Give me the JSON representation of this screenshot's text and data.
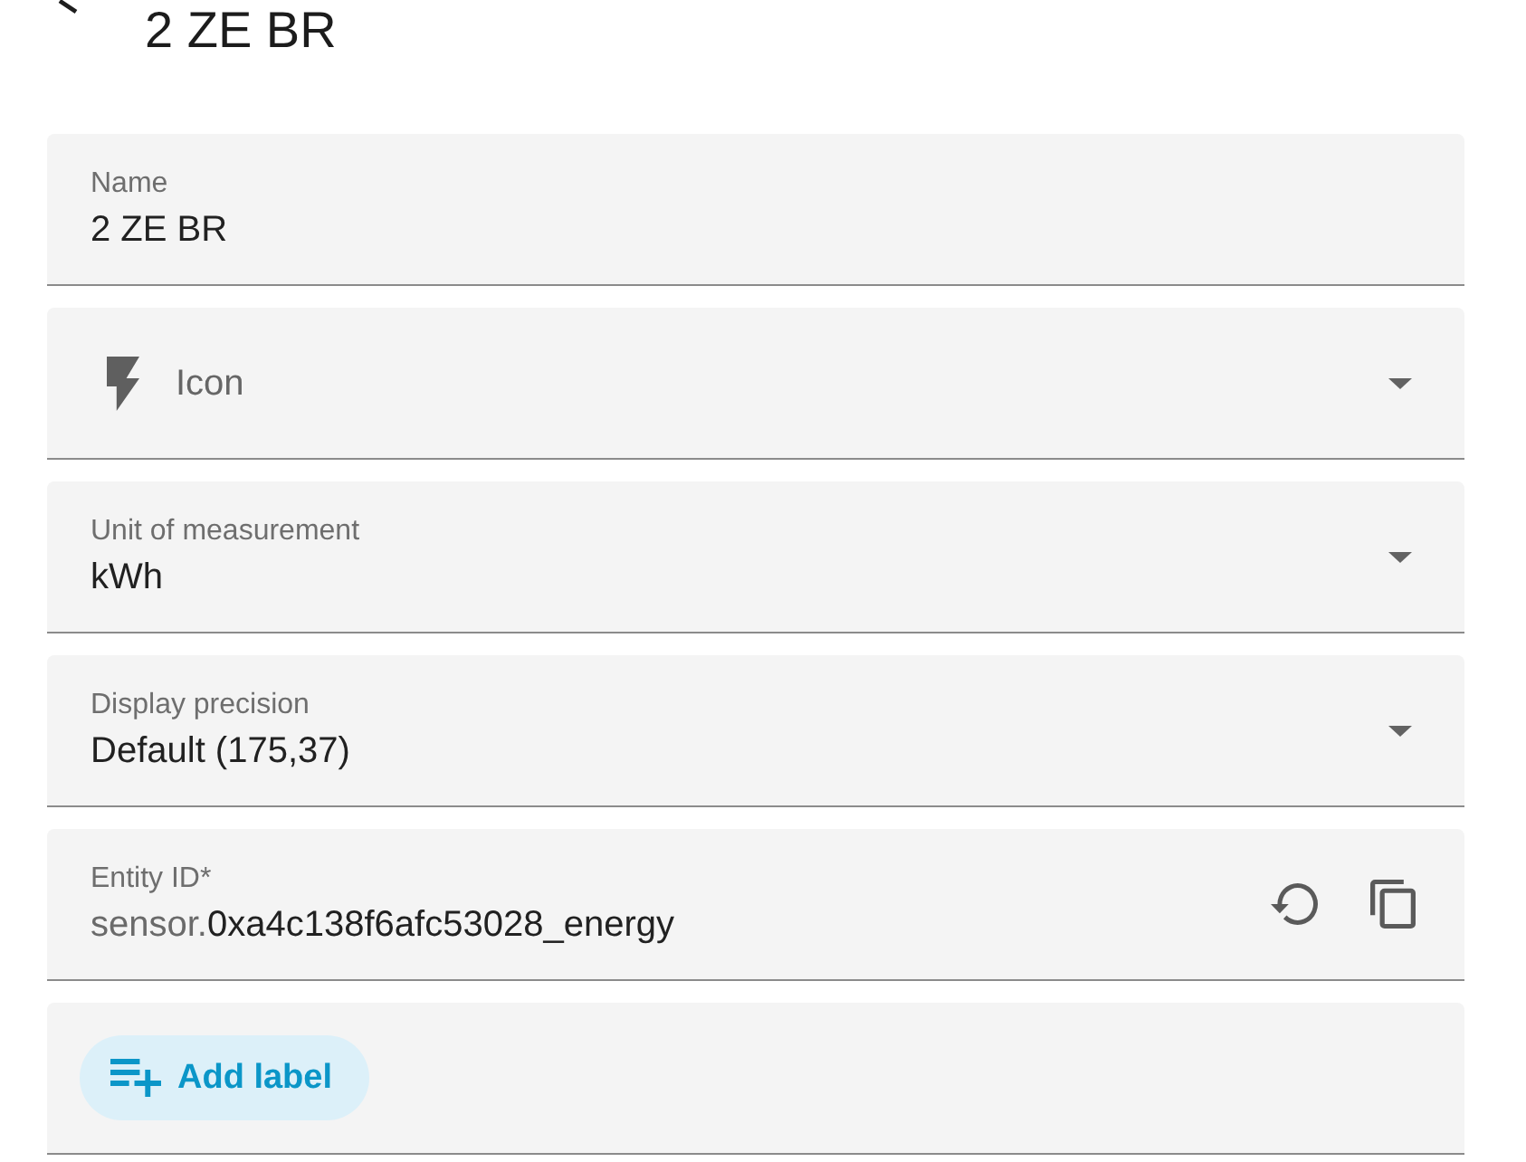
{
  "header": {
    "title": "2 ZE BR"
  },
  "fields": [
    {
      "kind": "text",
      "label": "Name",
      "value": "2 ZE BR"
    },
    {
      "kind": "icon_picker",
      "label": "Icon"
    },
    {
      "kind": "select",
      "label": "Unit of measurement",
      "value": "kWh"
    },
    {
      "kind": "select",
      "label": "Display precision",
      "value": "Default (175,37)"
    },
    {
      "kind": "entity_id",
      "label": "Entity ID*",
      "prefix": "sensor.",
      "value": "0xa4c138f6afc53028_energy"
    },
    {
      "kind": "labels",
      "button": "Add label"
    }
  ]
}
